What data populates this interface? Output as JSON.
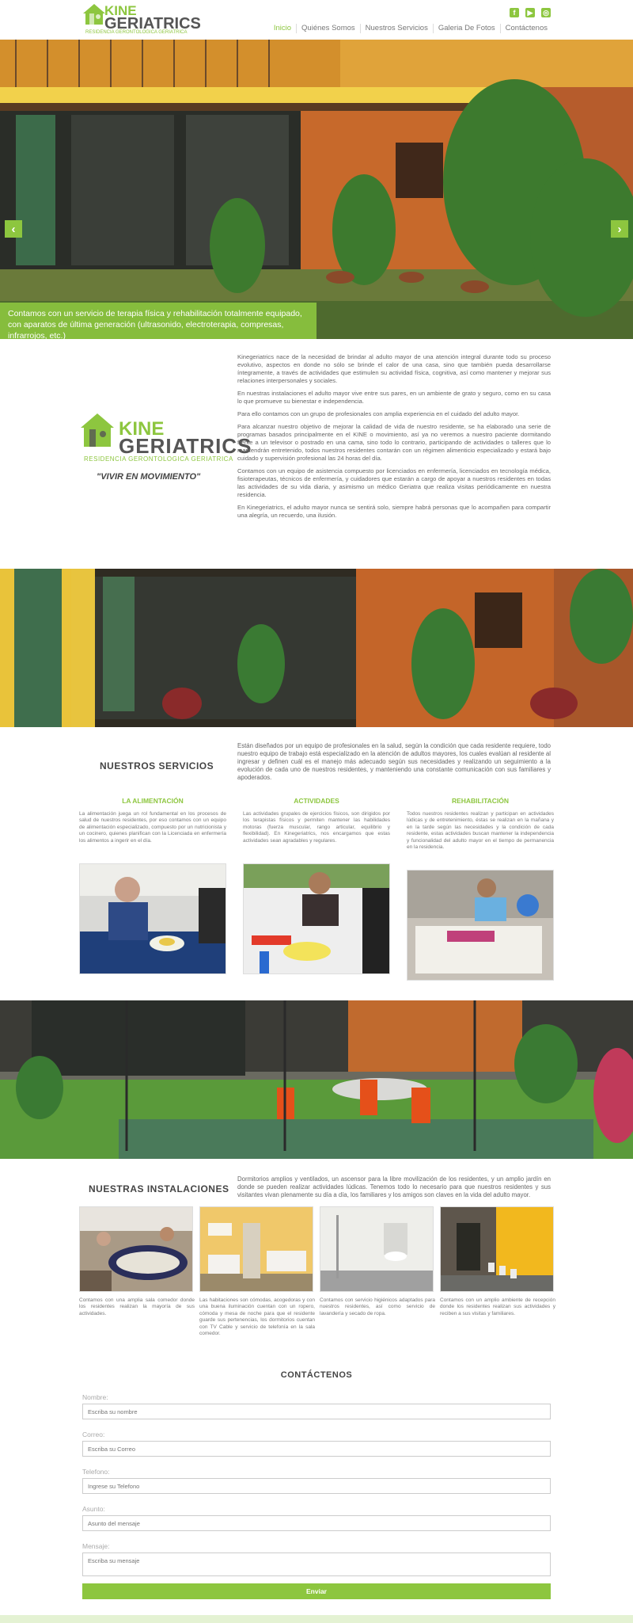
{
  "header": {
    "logo_top": "KINE",
    "logo_main": "GERIATRICS",
    "logo_sub": "RESIDENCIA GERONTOLOGICA GERIATRICA",
    "social": [
      "facebook-icon",
      "youtube-icon",
      "instagram-icon"
    ],
    "nav": [
      "Inicio",
      "Quiénes Somos",
      "Nuestros Servicios",
      "Galeria De Fotos",
      "Contáctenos"
    ]
  },
  "hero": {
    "caption": "Contamos con un servicio de terapia física y rehabilitación totalmente equipado, con aparatos de última generación (ultrasonido, electroterapia, compresas, infrarrojos, etc.)",
    "prev": "‹",
    "next": "›"
  },
  "intro": {
    "logo_top": "KINE",
    "logo_main": "GERIATRICS",
    "logo_sub": "RESIDENCIA GERONTOLOGICA GERIATRICA",
    "motto": "\"VIVIR EN MOVIMIENTO\"",
    "paragraphs": [
      "Kinegeriatrics nace de la necesidad de brindar al adulto mayor de una atención integral durante todo su proceso evolutivo, aspectos en donde no sólo se brinde el calor de una casa, sino que también pueda desarrollarse íntegramente, a través de actividades que estimulen su actividad física, cognitiva, así como mantener y mejorar sus relaciones interpersonales y sociales.",
      "En nuestras instalaciones el adulto mayor vive entre sus pares, en un ambiente de grato y seguro, como en su casa lo que promueve su bienestar e independencia.",
      "Para ello contamos con un grupo de profesionales con amplia experiencia en el cuidado del adulto mayor.",
      "Para alcanzar nuestro objetivo de mejorar la calidad de vida de nuestro residente, se ha elaborado una serie de programas basados principalmente en el KINE o movimiento, así ya no veremos a nuestro paciente dormitando frente a un televisor o postrado en una cama, sino todo lo contrario, participando de actividades o talleres que lo mantendrán entretenido, todos nuestros residentes contarán con un régimen alimenticio especializado y estará bajo cuidado y supervisión profesional las 24 horas del día.",
      "Contamos con un equipo de asistencia compuesto por licenciados en enfermería, licenciados en tecnología médica, fisioterapeutas, técnicos de enfermería, y cuidadores que estarán a cargo de apoyar a nuestros residentes en todas las actividades de su vida diaria, y asimismo un médico Geriatra que realiza visitas periódicamente en nuestra residencia.",
      "En Kinegeriatrics, el adulto mayor nunca se sentirá solo, siempre habrá personas que lo acompañen para compartir una alegría, un recuerdo, una ilusión."
    ]
  },
  "services": {
    "title": "NUESTROS SERVICIOS",
    "intro": "Están diseñados por un equipo de profesionales en la salud, según la condición que cada residente requiere, todo nuestro equipo de trabajo está especializado en la atención de adultos mayores, los cuales evalúan al residente al ingresar y definen cuál es el manejo más adecuado según sus necesidades y realizando un seguimiento a la evolución de cada uno de nuestros residentes, y manteniendo una constante comunicación con sus familiares y apoderados.",
    "columns": [
      {
        "title": "LA ALIMENTACIÓN",
        "text": "La alimentación juega un rol fundamental en los procesos de salud de nuestros residentes, por eso contamos con un equipo de alimentación especializado, compuesto por un nutricionista y un cocinero, quienes planifican con la Licenciada en enfermería los alimentos a ingerir en el día."
      },
      {
        "title": "ACTIVIDADES",
        "text": "Las actividades grupales de ejercicios físicos, son dirigidos por los terapistas físicos y permiten mantener las habilidades motoras (fuerza muscular, rango articular, equilibrio y flexibilidad). En Kinegeriatrics, nos encargamos que estas actividades sean agradables y regulares."
      },
      {
        "title": "REHABILITACIÓN",
        "text": "Todos nuestros residentes realizan y participan en actividades lúdicas y de entretenimiento, éstas se realizan en la mañana y en la tarde según las necesidades y la condición de cada residente, estas actividades buscan mantener la independencia y funcionalidad del adulto mayor en el tiempo de permanencia en la residencia."
      }
    ]
  },
  "facilities": {
    "title": "NUESTRAS INSTALACIONES",
    "intro": "Dormitorios amplios y ventilados, un ascensor para la libre movilización de los residentes, y un amplio jardín en donde se pueden realizar actividades lúdicas. Tenemos todo lo necesario para que nuestros residentes y sus visitantes vivan plenamente su día a día, los familiares y los amigos son claves en la vida del adulto mayor.",
    "items": [
      "Contamos con una amplia sala comedor donde los residentes realizan la mayoría de sus actividades.",
      "Las habitaciones son cómodas, acogedoras y con una buena iluminación cuentan con un ropero, cómoda y mesa de noche para que el residente guarde sus pertenencias, los dormitorios cuentan con TV Cable y servicio de telefonía en la sala comedor.",
      "Contamos con servicio higiénicos adaptados para nuestros residentes, así como servicio de lavandería y secado de ropa.",
      "Contamos con un amplio ambiente de recepción donde los residentes realizan sus actividades y reciben a sus visitas y familiares."
    ]
  },
  "contact": {
    "title": "CONTÁCTENOS",
    "fields": [
      {
        "label": "Nombre:",
        "placeholder": "Escriba su nombre"
      },
      {
        "label": "Correo:",
        "placeholder": "Escriba su Correo"
      },
      {
        "label": "Telefono:",
        "placeholder": "Ingrese su Telefono"
      },
      {
        "label": "Asunto:",
        "placeholder": "Asunto del mensaje"
      },
      {
        "label": "Mensaje:",
        "placeholder": "Escriba su mensaje"
      }
    ],
    "submit": "Enviar"
  },
  "colors": {
    "accent": "#8dc63f",
    "text": "#555555"
  }
}
